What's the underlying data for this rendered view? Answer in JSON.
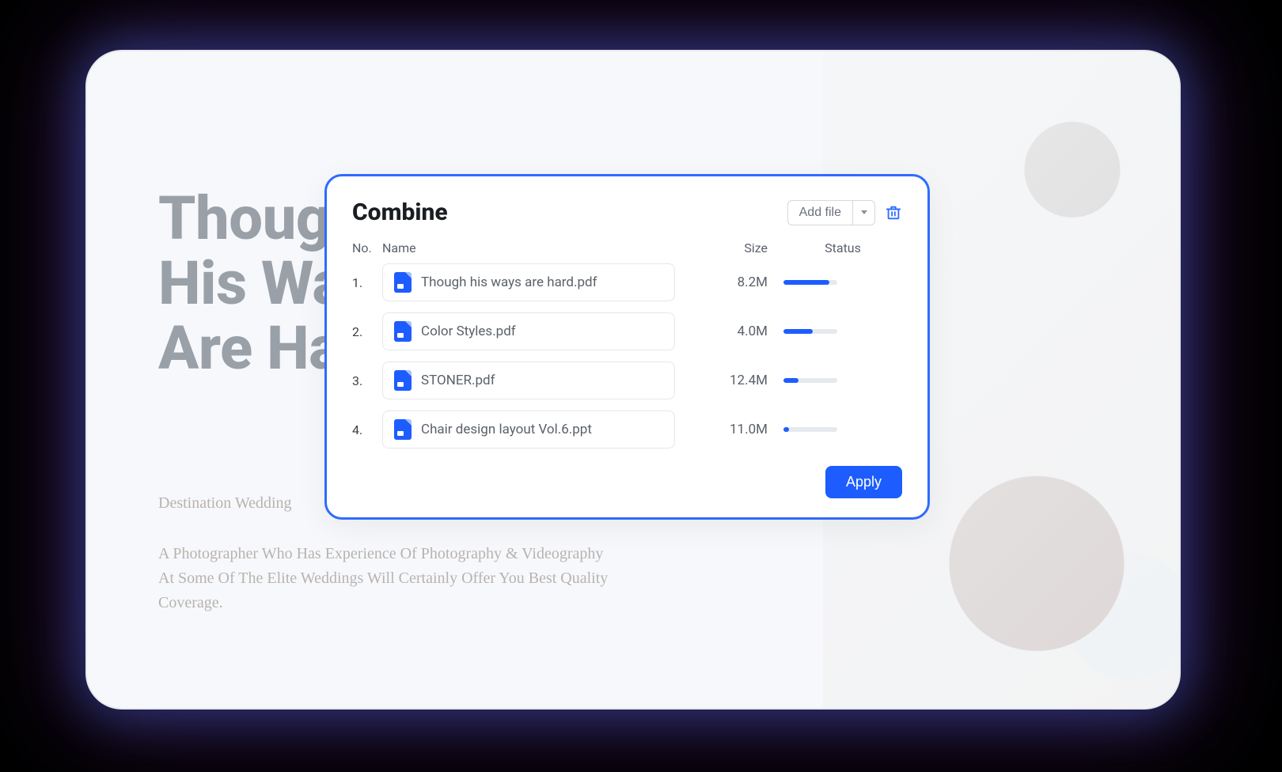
{
  "hero": {
    "title_l1": "Though",
    "title_l2": "His Ways",
    "title_l3": "Are Hard",
    "subtitle": "Destination Wedding",
    "paragraph": "A Photographer Who Has Experience Of Photography & Videography At Some Of The Elite Weddings Will Certainly Offer You Best Quality Coverage."
  },
  "dialog": {
    "title": "Combine",
    "add_file_label": "Add file",
    "apply_label": "Apply",
    "columns": {
      "no": "No.",
      "name": "Name",
      "size": "Size",
      "status": "Status"
    },
    "rows": [
      {
        "no": "1.",
        "name": "Though his ways are hard.pdf",
        "size": "8.2M",
        "progress_pct": 85
      },
      {
        "no": "2.",
        "name": "Color Styles.pdf",
        "size": "4.0M",
        "progress_pct": 55
      },
      {
        "no": "3.",
        "name": "STONER.pdf",
        "size": "12.4M",
        "progress_pct": 28
      },
      {
        "no": "4.",
        "name": "Chair design layout Vol.6.ppt",
        "size": "11.0M",
        "progress_pct": 10
      }
    ]
  }
}
